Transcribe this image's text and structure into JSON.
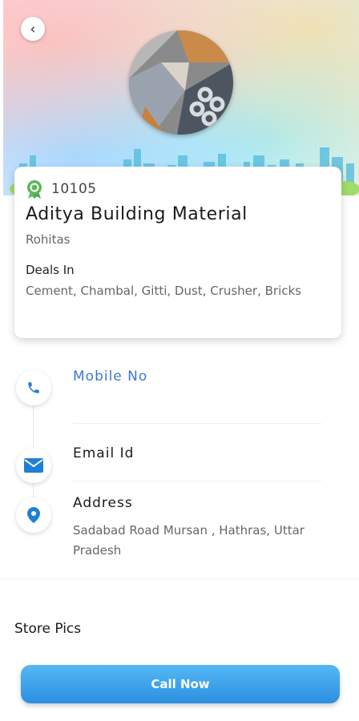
{
  "header": {
    "back_icon": "chevron-left-icon",
    "avatar_icon": "construction-materials-photo"
  },
  "card": {
    "code_icon": "award-badge-icon",
    "code": "10105",
    "name": "Aditya Building Material",
    "area": "Rohitas",
    "deals_title": "Deals In",
    "deals_text": "Cement, Chambal, Gitti, Dust, Crusher, Bricks"
  },
  "contact": {
    "mobile_label": "Mobile No",
    "mobile_icon": "phone-icon",
    "email_label": "Email Id",
    "email_icon": "mail-icon",
    "address_label": "Address",
    "address_icon": "location-pin-icon",
    "address_value": "Sadabad Road Mursan , Hathras, Uttar Pradesh"
  },
  "store_pics_title": "Store Pics",
  "call_button_label": "Call Now",
  "colors": {
    "accent": "#2b8fe0",
    "link": "#3c78d8",
    "badge": "#5cb85c",
    "icon_blue": "#1f7fd6"
  }
}
